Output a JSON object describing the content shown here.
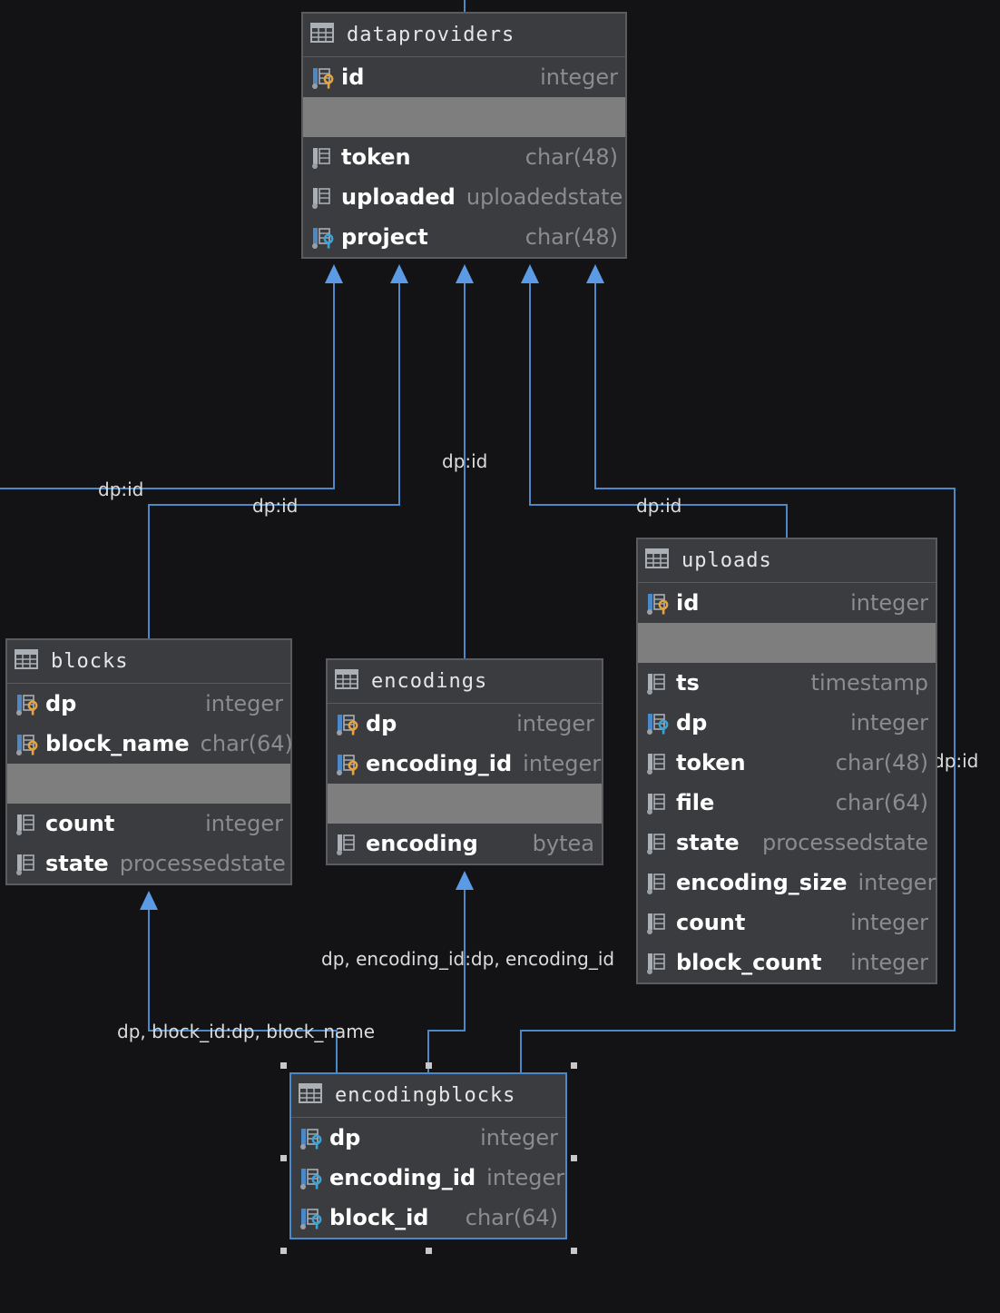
{
  "colors": {
    "background": "#131315",
    "table_bg": "#3a3c3f",
    "edge": "#4a88c7",
    "key_gold": "#e8a33d",
    "key_blue": "#3aa4d9"
  },
  "tables": {
    "dataproviders": {
      "name": "dataproviders",
      "pk": [
        {
          "name": "id",
          "type": "integer",
          "icon": "primary-key-icon"
        }
      ],
      "cols": [
        {
          "name": "token",
          "type": "char(48)",
          "icon": "column-icon"
        },
        {
          "name": "uploaded",
          "type": "uploadedstate",
          "icon": "column-icon"
        },
        {
          "name": "project",
          "type": "char(48)",
          "icon": "foreign-key-icon"
        }
      ]
    },
    "blocks": {
      "name": "blocks",
      "pk": [
        {
          "name": "dp",
          "type": "integer",
          "icon": "primary-foreign-key-icon"
        },
        {
          "name": "block_name",
          "type": "char(64)",
          "icon": "primary-key-icon"
        }
      ],
      "cols": [
        {
          "name": "count",
          "type": "integer",
          "icon": "column-icon"
        },
        {
          "name": "state",
          "type": "processedstate",
          "icon": "column-icon"
        }
      ]
    },
    "encodings": {
      "name": "encodings",
      "pk": [
        {
          "name": "dp",
          "type": "integer",
          "icon": "primary-foreign-key-icon"
        },
        {
          "name": "encoding_id",
          "type": "integer",
          "icon": "primary-key-icon"
        }
      ],
      "cols": [
        {
          "name": "encoding",
          "type": "bytea",
          "icon": "column-icon"
        }
      ]
    },
    "uploads": {
      "name": "uploads",
      "pk": [
        {
          "name": "id",
          "type": "integer",
          "icon": "primary-key-icon"
        }
      ],
      "cols": [
        {
          "name": "ts",
          "type": "timestamp",
          "icon": "column-icon"
        },
        {
          "name": "dp",
          "type": "integer",
          "icon": "foreign-key-icon"
        },
        {
          "name": "token",
          "type": "char(48)",
          "icon": "column-icon"
        },
        {
          "name": "file",
          "type": "char(64)",
          "icon": "column-icon"
        },
        {
          "name": "state",
          "type": "processedstate",
          "icon": "column-icon"
        },
        {
          "name": "encoding_size",
          "type": "integer",
          "icon": "column-icon"
        },
        {
          "name": "count",
          "type": "integer",
          "icon": "column-icon"
        },
        {
          "name": "block_count",
          "type": "integer",
          "icon": "column-icon"
        }
      ]
    },
    "encodingblocks": {
      "name": "encodingblocks",
      "pk": [],
      "cols": [
        {
          "name": "dp",
          "type": "integer",
          "icon": "foreign-key-icon"
        },
        {
          "name": "encoding_id",
          "type": "integer",
          "icon": "foreign-key-icon"
        },
        {
          "name": "block_id",
          "type": "char(64)",
          "icon": "foreign-key-icon"
        }
      ]
    }
  },
  "edges": [
    {
      "from": "blocks",
      "to": "dataproviders",
      "label": "dp:id"
    },
    {
      "from": "blocks",
      "to": "dataproviders",
      "label": "dp:id"
    },
    {
      "from": "encodings",
      "to": "dataproviders",
      "label": "dp:id"
    },
    {
      "from": "uploads",
      "to": "dataproviders",
      "label": "dp:id"
    },
    {
      "from": "encodingblocks",
      "to": "dataproviders",
      "label": "dp:id"
    },
    {
      "from": "encodingblocks",
      "to": "encodings",
      "label": "dp, encoding_id:dp, encoding_id"
    },
    {
      "from": "encodingblocks",
      "to": "blocks",
      "label": "dp, block_id:dp, block_name"
    }
  ]
}
